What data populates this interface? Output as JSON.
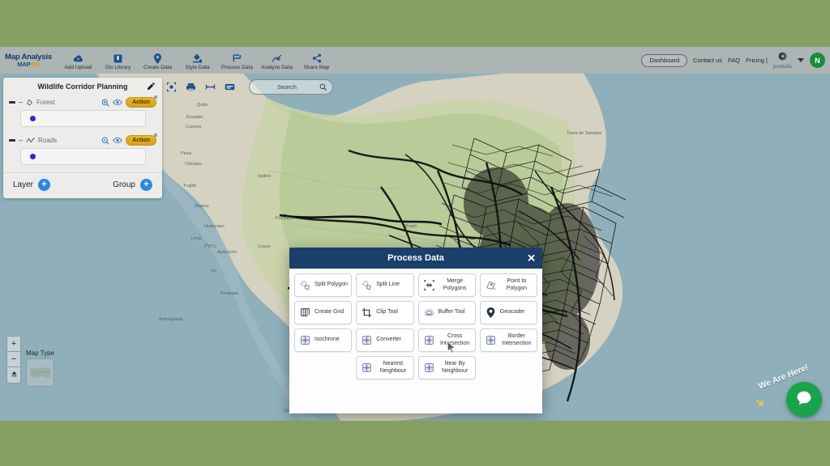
{
  "page": {
    "background_color": "#859f63"
  },
  "topnav": {
    "brand_title": "Map Analysis",
    "brand_logo_primary": "MAP",
    "brand_logo_accent": "OG",
    "items": [
      {
        "label": "Add Upload",
        "icon": "cloud-upload-icon"
      },
      {
        "label": "Gis Library",
        "icon": "library-icon"
      },
      {
        "label": "Create Data",
        "icon": "map-pin-icon"
      },
      {
        "label": "Style Data",
        "icon": "paint-bucket-icon"
      },
      {
        "label": "Process Data",
        "icon": "process-flag-icon"
      },
      {
        "label": "Analyze Data",
        "icon": "analyze-chart-icon"
      },
      {
        "label": "Share Map",
        "icon": "share-icon"
      }
    ],
    "right": {
      "dashboard": "Dashboard",
      "contact": "Contact us",
      "faq": "FAQ",
      "pricing": "Pricing |",
      "products_label": "products",
      "avatar_initial": "N",
      "avatar_color": "#1a8c3c"
    }
  },
  "layer_panel": {
    "title": "Wildlife Corridor Planning",
    "edit_icon": "pencil-icon",
    "layers": [
      {
        "name": "Forest",
        "type_icon": "polygon-icon",
        "zoom_icon": "zoom-in-icon",
        "visible_icon": "eye-icon",
        "action_label": "Action",
        "style_dot_color": "#3b22c9"
      },
      {
        "name": "Roads",
        "type_icon": "line-icon",
        "zoom_icon": "zoom-out-icon",
        "visible_icon": "eye-icon",
        "action_label": "Action",
        "style_dot_color": "#3b22c9"
      }
    ],
    "footer": {
      "layer_label": "Layer",
      "group_label": "Group",
      "add_symbol": "+"
    }
  },
  "map_toolbar": {
    "icons": [
      "fullscreen-target-icon",
      "print-icon",
      "measure-icon",
      "legend-icon"
    ],
    "search_placeholder": "Search",
    "search_value": "",
    "search_icon": "search-icon"
  },
  "map_controls": {
    "zoom_in": "+",
    "zoom_out": "−",
    "compass": "⌃",
    "map_type_label": "Map Type"
  },
  "help_widget": {
    "text": "We Are Here!",
    "chat_icon": "chat-bubble-icon",
    "chat_color": "#1aa34a"
  },
  "modal": {
    "title": "Process Data",
    "close_icon": "close-icon",
    "header_color": "#1a3f6b",
    "tools": [
      {
        "label": "Split Polygon",
        "icon": "split-polygon-icon",
        "centered": false
      },
      {
        "label": "Split Line",
        "icon": "split-line-icon",
        "centered": false
      },
      {
        "label": "Merge Polygons",
        "icon": "merge-icon",
        "centered": true
      },
      {
        "label": "Point to Polygon",
        "icon": "point-to-polygon-icon",
        "centered": true
      },
      {
        "label": "Create Grid",
        "icon": "grid-icon",
        "centered": false
      },
      {
        "label": "Clip Tool",
        "icon": "crop-icon",
        "centered": false
      },
      {
        "label": "Buffer Tool",
        "icon": "buffer-icon",
        "centered": false
      },
      {
        "label": "Geocoder",
        "icon": "geocode-pin-icon",
        "centered": false
      },
      {
        "label": "Isochrone",
        "icon": "isochrone-icon",
        "centered": false
      },
      {
        "label": "Converter",
        "icon": "converter-icon",
        "centered": false
      },
      {
        "label": "Cross Intersection",
        "icon": "cross-intersection-icon",
        "centered": true
      },
      {
        "label": "Border Intersection",
        "icon": "border-intersection-icon",
        "centered": true
      },
      {
        "label": "Nearest Neighbour",
        "icon": "nearest-neighbour-icon",
        "centered": true
      },
      {
        "label": "Near By Neighbour",
        "icon": "near-by-neighbour-icon",
        "centered": true
      }
    ],
    "hovered_tool": "Cross Intersection"
  }
}
